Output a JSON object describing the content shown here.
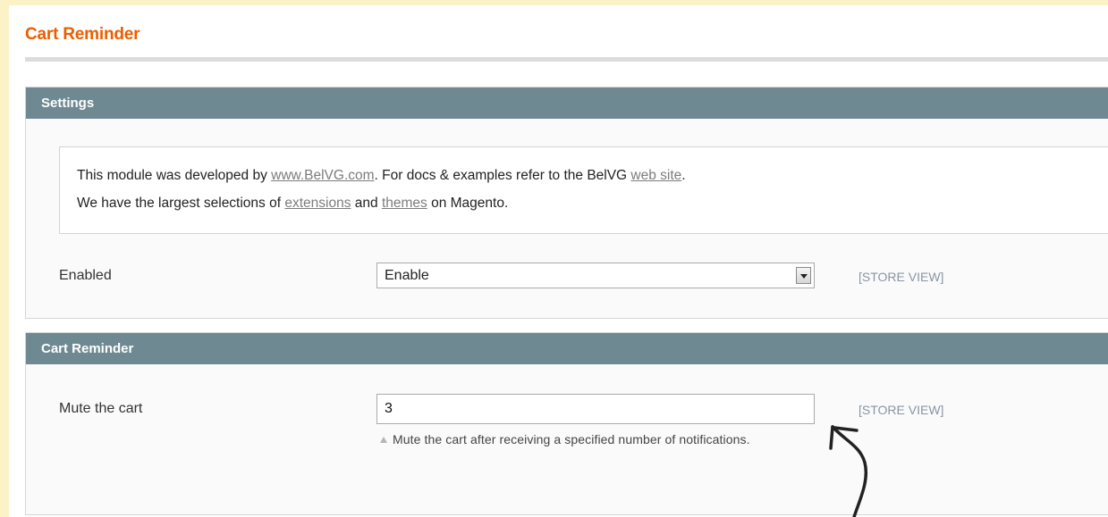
{
  "page": {
    "title": "Cart Reminder",
    "accent_color": "#eb5e00",
    "section_header_color": "#6f8992"
  },
  "settings": {
    "header": "Settings",
    "notice": {
      "line1_prefix": "This module was developed by ",
      "line1_link1": "www.BelVG.com",
      "line1_middle": ". For docs & examples refer to the BelVG ",
      "line1_link2": "web site",
      "line1_suffix": ".",
      "line2_prefix": "We have the largest selections of ",
      "line2_link1": "extensions",
      "line2_middle": " and ",
      "line2_link2": "themes",
      "line2_suffix": " on Magento."
    },
    "enabled": {
      "label": "Enabled",
      "selected": "Enable",
      "scope": "[STORE VIEW]"
    }
  },
  "cart_reminder": {
    "header": "Cart Reminder",
    "mute": {
      "label": "Mute the cart",
      "value": "3",
      "scope": "[STORE VIEW]",
      "hint": "Mute the cart after receiving a specified number of notifications."
    }
  },
  "annotation": {
    "icon": "hand-drawn-arrow-icon"
  }
}
